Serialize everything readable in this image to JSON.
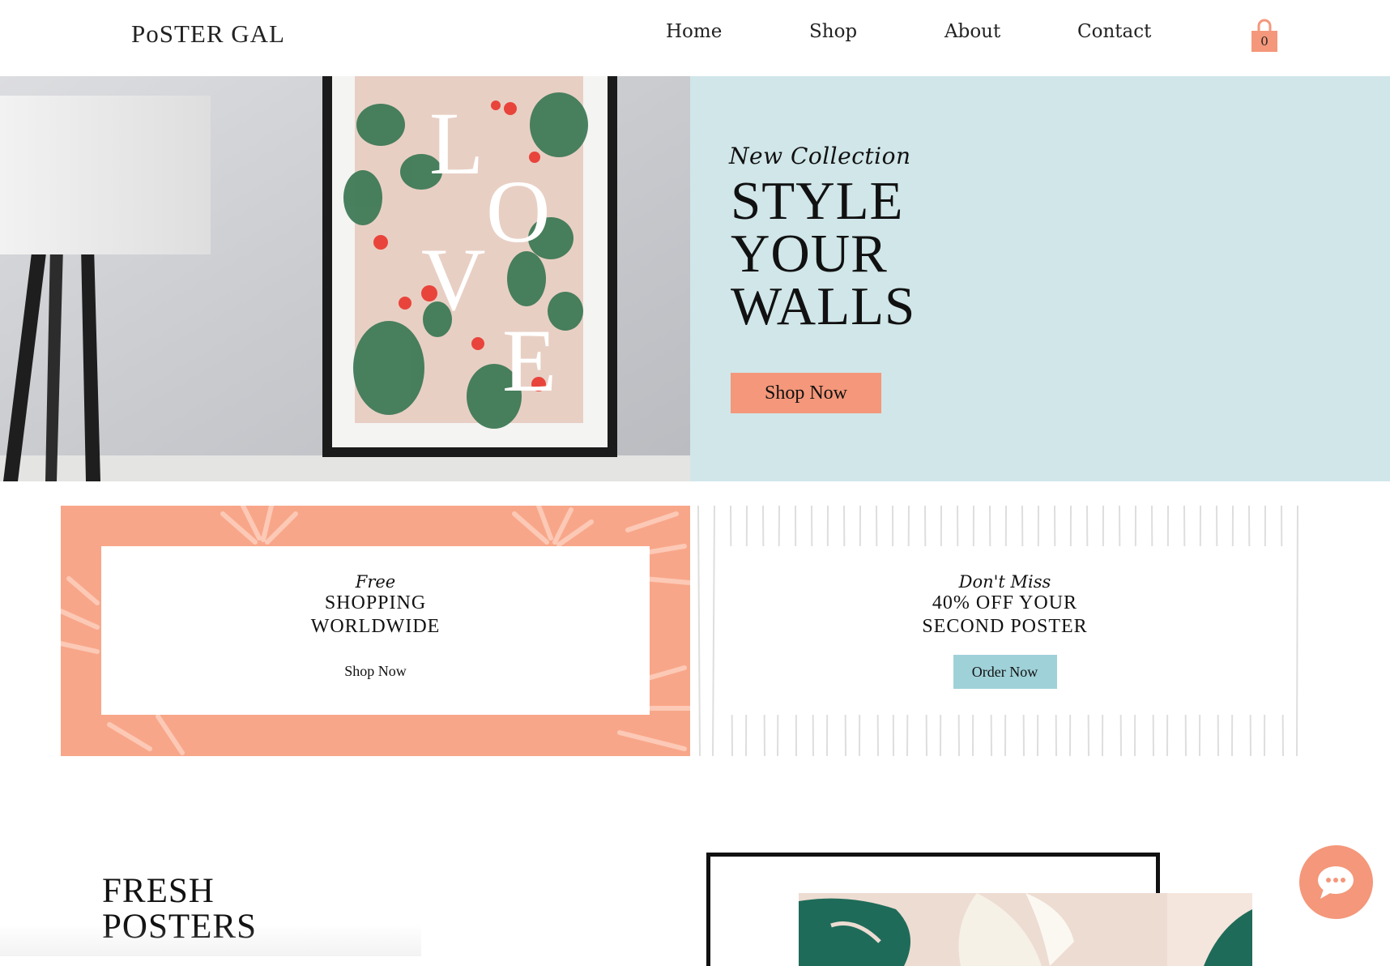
{
  "brand": {
    "name": "PoSTER GAL"
  },
  "nav": {
    "items": [
      "Home",
      "Shop",
      "About",
      "Contact"
    ]
  },
  "cart": {
    "count": "0"
  },
  "hero": {
    "poster_letters": [
      "L",
      "O",
      "V",
      "E"
    ],
    "eyebrow": "New Collection",
    "title_lines": [
      "STYLE",
      "YOUR",
      "WALLS"
    ],
    "button": "Shop Now"
  },
  "promos": [
    {
      "script": "Free",
      "heading_lines": [
        "SHOPPING",
        "WORLDWIDE"
      ],
      "link": "Shop Now"
    },
    {
      "script": "Don't Miss",
      "heading_lines": [
        "40% OFF YOUR",
        "SECOND POSTER"
      ],
      "button": "Order Now"
    }
  ],
  "fresh": {
    "title_lines": [
      "FRESH",
      "POSTERS"
    ]
  },
  "colors": {
    "accent_salmon": "#f4977a",
    "accent_teal": "#9fd1d8",
    "hero_teal_bg": "#d0e6e9",
    "text": "#111111"
  },
  "icons": {
    "cart": "shopping-bag-icon",
    "chat": "chat-bubble-icon"
  }
}
